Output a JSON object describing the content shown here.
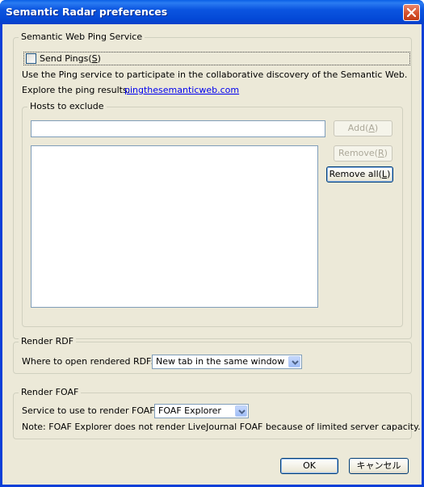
{
  "window": {
    "title": "Semantic Radar preferences"
  },
  "ping": {
    "group_label": "Semantic Web Ping Service",
    "send_pings_label": "Send Pings(",
    "send_pings_key": "S",
    "send_pings_close": ")",
    "send_pings_checked": false,
    "description": "Use the Ping service to participate in the collaborative discovery of the Semantic Web.",
    "explore_label": "Explore the ping results:",
    "explore_link": "pingthesemanticweb.com",
    "hosts": {
      "group_label": "Hosts to exclude",
      "input_value": "",
      "add_label": "Add(",
      "add_key": "A",
      "add_close": ")",
      "remove_label": "Remove(",
      "remove_key": "R",
      "remove_close": ")",
      "remove_all_label": "Remove all(",
      "remove_all_key": "L",
      "remove_all_close": ")",
      "list_items": []
    }
  },
  "rdf": {
    "group_label": "Render RDF",
    "open_label": "Where to open rendered RDF:",
    "open_value": "New tab in the same window"
  },
  "foaf": {
    "group_label": "Render FOAF",
    "service_label": "Service to use to render FOAF:",
    "service_value": "FOAF Explorer",
    "note": "Note: FOAF Explorer does not render LiveJournal FOAF because of limited server capacity."
  },
  "footer": {
    "ok_label": "OK",
    "cancel_label": "キャンセル"
  }
}
